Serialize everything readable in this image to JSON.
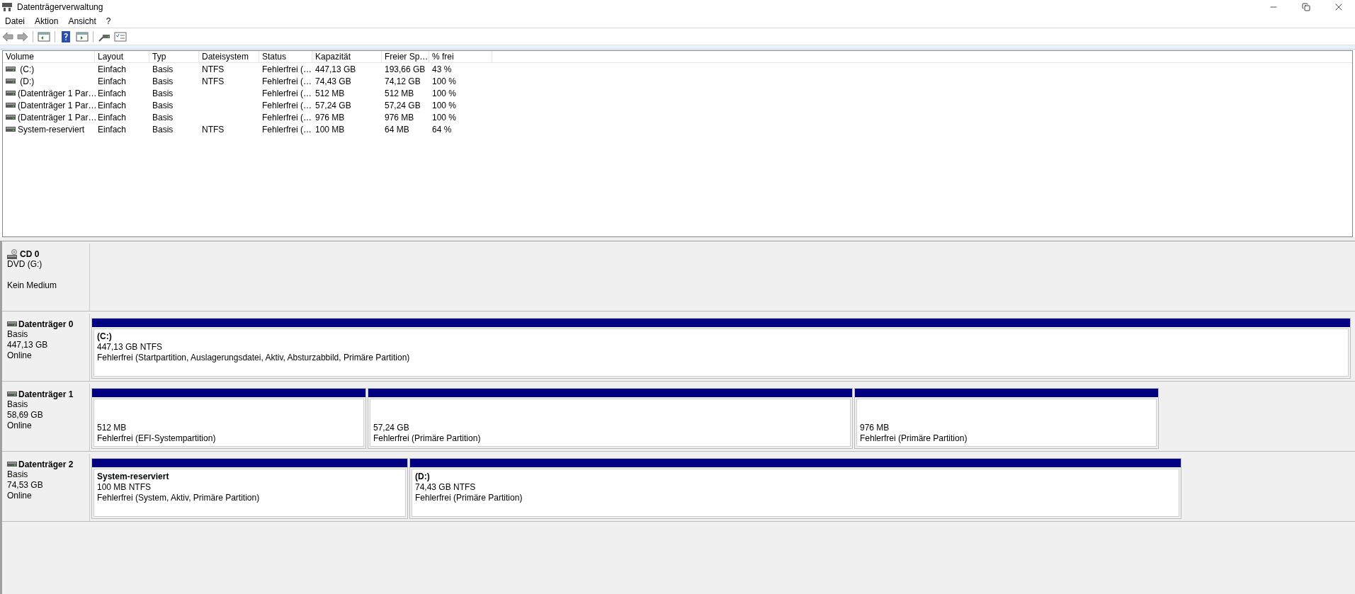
{
  "window": {
    "title": "Datenträgerverwaltung"
  },
  "menu": [
    "Datei",
    "Aktion",
    "Ansicht",
    "?"
  ],
  "toolbar": {
    "back": {
      "disabled": true
    },
    "forward": {
      "disabled": true
    }
  },
  "table": {
    "columns": [
      "Volume",
      "Layout",
      "Typ",
      "Dateisystem",
      "Status",
      "Kapazität",
      "Freier Sp…",
      "% frei"
    ],
    "rows": [
      {
        "cells": [
          " (C:)",
          "Einfach",
          "Basis",
          "NTFS",
          "Fehlerfrei (…",
          "447,13 GB",
          "193,66 GB",
          "43 %"
        ]
      },
      {
        "cells": [
          " (D:)",
          "Einfach",
          "Basis",
          "NTFS",
          "Fehlerfrei (…",
          "74,43 GB",
          "74,12 GB",
          "100 %"
        ]
      },
      {
        "cells": [
          "(Datenträger 1 Par…",
          "Einfach",
          "Basis",
          "",
          "Fehlerfrei (…",
          "512 MB",
          "512 MB",
          "100 %"
        ]
      },
      {
        "cells": [
          "(Datenträger 1 Par…",
          "Einfach",
          "Basis",
          "",
          "Fehlerfrei (…",
          "57,24 GB",
          "57,24 GB",
          "100 %"
        ]
      },
      {
        "cells": [
          "(Datenträger 1 Par…",
          "Einfach",
          "Basis",
          "",
          "Fehlerfrei (…",
          "976 MB",
          "976 MB",
          "100 %"
        ]
      },
      {
        "cells": [
          "System-reserviert",
          "Einfach",
          "Basis",
          "NTFS",
          "Fehlerfrei (…",
          "100 MB",
          "64 MB",
          "64 %"
        ]
      }
    ]
  },
  "disks": [
    {
      "kind": "cd",
      "name": "CD 0",
      "type": "DVD (G:)",
      "status": "Kein Medium"
    },
    {
      "kind": "disk",
      "name": "Datenträger 0",
      "type": "Basis",
      "size": "447,13 GB",
      "status": "Online",
      "partitions": [
        {
          "label": "(C:)",
          "size": "447,13 GB NTFS",
          "health": "Fehlerfrei (Startpartition, Auslagerungsdatei, Aktiv, Absturzabbild, Primäre Partition)"
        }
      ]
    },
    {
      "kind": "disk",
      "name": "Datenträger 1",
      "type": "Basis",
      "size": "58,69 GB",
      "status": "Online",
      "partitions": [
        {
          "size": "512 MB",
          "health": "Fehlerfrei (EFI-Systempartition)"
        },
        {
          "size": "57,24 GB",
          "health": "Fehlerfrei (Primäre Partition)"
        },
        {
          "size": "976 MB",
          "health": "Fehlerfrei (Primäre Partition)"
        }
      ]
    },
    {
      "kind": "disk",
      "name": "Datenträger 2",
      "type": "Basis",
      "size": "74,53 GB",
      "status": "Online",
      "partitions": [
        {
          "label": "System-reserviert",
          "size": "100 MB NTFS",
          "health": "Fehlerfrei (System, Aktiv, Primäre Partition)"
        },
        {
          "label": "(D:)",
          "size": "74,43 GB NTFS",
          "health": "Fehlerfrei (Primäre Partition)"
        }
      ]
    }
  ]
}
